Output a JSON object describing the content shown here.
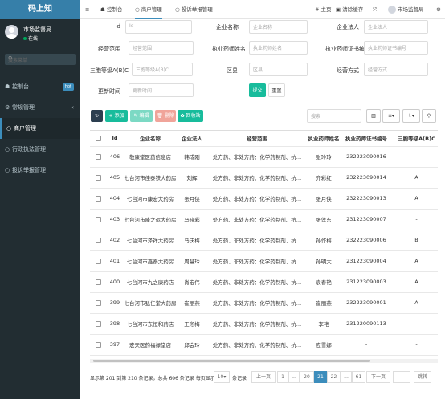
{
  "sidebar": {
    "brand": "码上知",
    "user_name": "市场监督局",
    "user_status": "在线",
    "search_placeholder": "搜索菜单",
    "items": [
      {
        "label": "控制台",
        "icon": "dashboard-icon",
        "badge": "hot"
      },
      {
        "label": "常规管理",
        "icon": "cogs-icon"
      },
      {
        "label": "商户管理",
        "icon": "circle-icon"
      },
      {
        "label": "行政执法管理",
        "icon": "circle-icon"
      },
      {
        "label": "投诉举报管理",
        "icon": "circle-icon"
      }
    ]
  },
  "topbar": {
    "menu_icon": "≡",
    "tabs": [
      "控制台",
      "商户管理",
      "投诉举报管理"
    ],
    "home": "主页",
    "clear_cache": "清除缓存",
    "admin_name": "市场监督局"
  },
  "filters": {
    "id_label": "Id",
    "id_placeholder": "Id",
    "company_label": "企业名称",
    "company_placeholder": "企业名称",
    "legal_label": "企业法人",
    "legal_placeholder": "企业法人",
    "scope_label": "经营范围",
    "scope_placeholder": "经营范围",
    "pharmacist_label": "执业药师姓名",
    "pharmacist_placeholder": "执业药师姓名",
    "cert_label": "执业药师证书编",
    "cert_placeholder": "执业药师证书编号",
    "grade_label": "三胞等级A(B)C",
    "grade_placeholder": "三胞等级A(B)C",
    "area_label": "区县",
    "area_placeholder": "区县",
    "mode_label": "经营方式",
    "mode_placeholder": "经营方式",
    "update_label": "更新时间",
    "update_placeholder": "更新时间",
    "submit": "提交",
    "reset": "重置"
  },
  "toolbar": {
    "refresh": "↻",
    "add": "+ 添加",
    "edit": "✎ 编辑",
    "delete": "🗑 删除",
    "recycle": "✿ 回收站",
    "search_placeholder": "搜索"
  },
  "table": {
    "headers": [
      "Id",
      "企业名称",
      "企业法人",
      "经营范围",
      "执业药师姓名",
      "执业药师证书编号",
      "三胞等级A(B)C"
    ],
    "rows": [
      [
        "406",
        "敬康堂医药信息店",
        "韩成刚",
        "处方药、非处方药：化学药制剂、抗…",
        "张玲玲",
        "232223090016",
        "-"
      ],
      [
        "405",
        "七台河市佳泰铁大药房",
        "刘辉",
        "处方药、非处方药：化学药制剂、抗…",
        "齐彩红",
        "232223090014",
        "A"
      ],
      [
        "404",
        "七台河市康宏大药房",
        "张月侠",
        "处方药、非处方药：化学药制剂、抗…",
        "张月侠",
        "232223090013",
        "A"
      ],
      [
        "403",
        "七台河市隆之运大药房",
        "马晓彩",
        "处方药、非处方药：化学药制剂、抗…",
        "张莲东",
        "231223090007",
        "-"
      ],
      [
        "402",
        "七台河市泽祥大药房",
        "马庆梅",
        "处方药、非处方药：化学药制剂、抗…",
        "孙作梅",
        "232223090006",
        "B"
      ],
      [
        "401",
        "七台河市鑫泰大药房",
        "周慧玲",
        "处方药、非处方药：化学药制剂、抗…",
        "孙明大",
        "231223090004",
        "A"
      ],
      [
        "400",
        "七台河市九之康药店",
        "肖宏伟",
        "处方药、非处方药：化学药制剂、抗…",
        "袁春艳",
        "231223090003",
        "A"
      ],
      [
        "399",
        "七台河市弘仁堂大药房",
        "崔丽燕",
        "处方药、非处方药：化学药制剂、抗…",
        "崔丽燕",
        "232223090001",
        "A"
      ],
      [
        "398",
        "七台河市东恒和药店",
        "王冬梅",
        "处方药、非处方药：化学药制剂、抗…",
        "李艳",
        "231220090113",
        "-"
      ],
      [
        "397",
        "宏天医药福禄堂店",
        "邱会玲",
        "处方药、非处方药：化学药制剂、抗…",
        "应雪娜",
        "-",
        "-"
      ]
    ]
  },
  "pagination": {
    "summary": "显示第 201 到第 210 条记录，总共 606 条记录 每页显示",
    "page_size": "10",
    "records_suffix": "条记录",
    "prev": "上一页",
    "pages": [
      "1",
      "...",
      "20",
      "21",
      "22",
      "...",
      "61"
    ],
    "next": "下一页",
    "jump": "跳转"
  }
}
